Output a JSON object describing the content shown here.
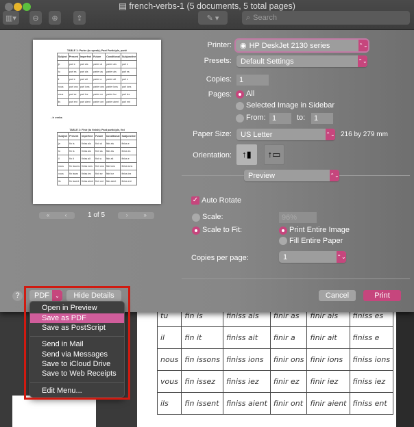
{
  "window": {
    "title": "french-verbs-1 (5 documents, 5 total pages)",
    "traffic_colors": [
      "#ee5e57",
      "#f4bf2f",
      "#60c93f"
    ]
  },
  "toolbar": {
    "search_placeholder": "Search"
  },
  "preview": {
    "table1_title": "TABLE 1: Parler (to speak); Past Participle, parlé",
    "section": "- ir verbs",
    "table2_title": "TABLE 2: Finir (to finish); Past participle, fini",
    "headers": [
      "Subject",
      "Present",
      "Imperfect",
      "Future",
      "Conditional",
      "Subjunctive"
    ],
    "table1": [
      [
        "je",
        "parl e",
        "parl ais",
        "parler ai",
        "parler ais",
        "parl e"
      ],
      [
        "tu",
        "parl es",
        "parl ais",
        "parler as",
        "parler ais",
        "parl es"
      ],
      [
        "il",
        "parl e",
        "parl ait",
        "parler a",
        "parler ait",
        "parl e"
      ],
      [
        "nous",
        "parl ons",
        "parl ions",
        "parler ons",
        "parler ions",
        "parl ions"
      ],
      [
        "vous",
        "parl ez",
        "parl iez",
        "parler ez",
        "parler iez",
        "parl iez"
      ],
      [
        "ils",
        "parl ent",
        "parl aient",
        "parler ont",
        "parler aient",
        "parl ent"
      ]
    ],
    "table2": [
      [
        "je",
        "fin is",
        "finiss ais",
        "finir ai",
        "finir ais",
        "finiss e"
      ],
      [
        "tu",
        "fin is",
        "finiss ais",
        "finir as",
        "finir ais",
        "finiss es"
      ],
      [
        "il",
        "fin it",
        "finiss ait",
        "finir a",
        "finir ait",
        "finiss e"
      ],
      [
        "nous",
        "fin issons",
        "finiss ions",
        "finir ons",
        "finir ions",
        "finiss ions"
      ],
      [
        "vous",
        "fin issez",
        "finiss iez",
        "finir ez",
        "finir iez",
        "finiss iez"
      ],
      [
        "ils",
        "fin issent",
        "finiss aient",
        "finir ont",
        "finir aient",
        "finiss ent"
      ]
    ],
    "page_indicator": "1 of 5"
  },
  "settings": {
    "printer_label": "Printer:",
    "printer": "HP DeskJet 2130 series",
    "presets_label": "Presets:",
    "presets": "Default Settings",
    "copies_label": "Copies:",
    "copies": "1",
    "pages_label": "Pages:",
    "pages_all": "All",
    "pages_selected": "Selected Image in Sidebar",
    "pages_from": "From:",
    "from_value": "1",
    "to_label": "to:",
    "to_value": "1",
    "paper_label": "Paper Size:",
    "paper": "US Letter",
    "paper_dims": "216 by 279 mm",
    "orientation_label": "Orientation:",
    "app_section": "Preview",
    "auto_rotate": "Auto Rotate",
    "auto_rotate_checked": true,
    "scale_label": "Scale:",
    "scale_value": "96%",
    "scale_to_fit": "Scale to Fit:",
    "print_entire": "Print Entire Image",
    "fill_paper": "Fill Entire Paper",
    "copies_per_page_label": "Copies per page:",
    "copies_per_page": "1"
  },
  "footer": {
    "help": "?",
    "pdf": "PDF",
    "hide_details": "Hide Details",
    "cancel": "Cancel",
    "print": "Print"
  },
  "pdf_menu": {
    "items": [
      "Open in Preview",
      "Save as PDF",
      "Save as PostScript",
      "Send in Mail",
      "Send via Messages",
      "Save to iCloud Drive",
      "Save to Web Receipts",
      "Edit Menu..."
    ],
    "highlighted": "Save as PDF"
  },
  "background_table": [
    [
      "tu",
      "fin is",
      "finiss ais",
      "finir as",
      "finir ais",
      "finiss es"
    ],
    [
      "il",
      "fin it",
      "finiss ait",
      "finir a",
      "finir ait",
      "finiss e"
    ],
    [
      "nous",
      "fin issons",
      "finiss ions",
      "finir ons",
      "finir ions",
      "finiss ions"
    ],
    [
      "vous",
      "fin issez",
      "finiss iez",
      "finir ez",
      "finir iez",
      "finiss iez"
    ],
    [
      "ils",
      "fin issent",
      "finiss aient",
      "finir ont",
      "finir aient",
      "finiss ent"
    ]
  ],
  "colors": {
    "accent": "#c6467d",
    "highlight": "#d05d9b",
    "annotation": "#d01a10"
  }
}
